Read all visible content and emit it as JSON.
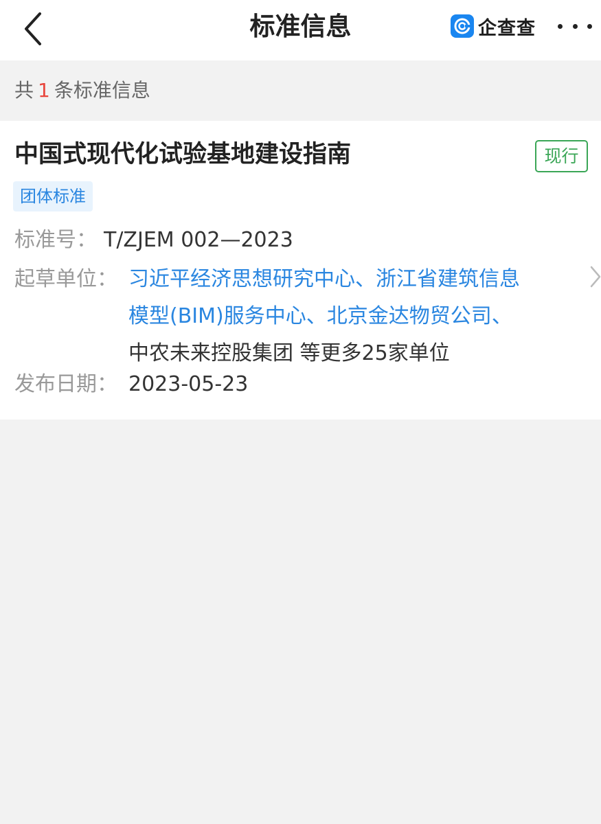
{
  "nav": {
    "title": "标准信息",
    "brand": "企查查"
  },
  "summary": {
    "prefix": "共",
    "count": "1",
    "suffix": "条标准信息"
  },
  "standard": {
    "title": "中国式现代化试验基地建设指南",
    "status": "现行",
    "type": "团体标准",
    "number_label": "标准号：",
    "number": "T/ZJEM 002—2023",
    "drafter_label": "起草单位：",
    "drafter_lines": [
      "习近平经济思想研究中心、浙江省建筑信息",
      "模型(BIM)服务中心、北京金达物贸公司、"
    ],
    "drafter_plain": "中农未来控股集团 等更多25家单位",
    "date_label": "发布日期：",
    "date": "2023-05-23"
  },
  "colors": {
    "accent_blue": "#2a86e0",
    "status_green": "#3aa656",
    "count_red": "#e8453c",
    "page_bg": "#f2f2f2"
  }
}
